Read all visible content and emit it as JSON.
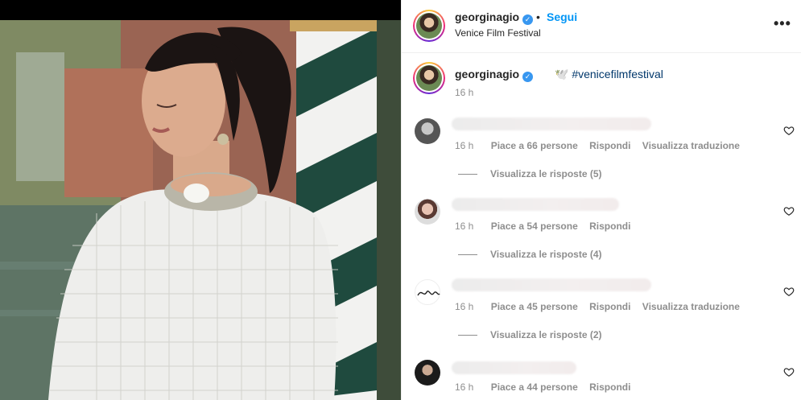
{
  "post": {
    "username": "georginagio",
    "verified_mark": "✓",
    "follow_label": "Segui",
    "separator": "•",
    "location": "Venice Film Festival",
    "more_icon": "more-horizontal-icon",
    "more_label": "•••"
  },
  "caption": {
    "username": "georginagio",
    "text": "🕊️ #venicefilmfestival",
    "time": "16 h"
  },
  "comments": [
    {
      "time": "16 h",
      "likes": "Piace a 66 persone",
      "reply": "Rispondi",
      "translate": "Visualizza traduzione",
      "view_replies": "Visualizza le risposte (5)"
    },
    {
      "time": "16 h",
      "likes": "Piace a 54 persone",
      "reply": "Rispondi",
      "translate": "",
      "view_replies": "Visualizza le risposte (4)"
    },
    {
      "time": "16 h",
      "likes": "Piace a 45 persone",
      "reply": "Rispondi",
      "translate": "Visualizza traduzione",
      "view_replies": "Visualizza le risposte (2)"
    },
    {
      "time": "16 h",
      "likes": "Piace a 44 persone",
      "reply": "Rispondi",
      "translate": "",
      "view_replies": ""
    }
  ],
  "colors": {
    "link": "#00376b",
    "follow": "#0095f6",
    "secondary": "#8e8e8e",
    "verified": "#3897f0"
  }
}
